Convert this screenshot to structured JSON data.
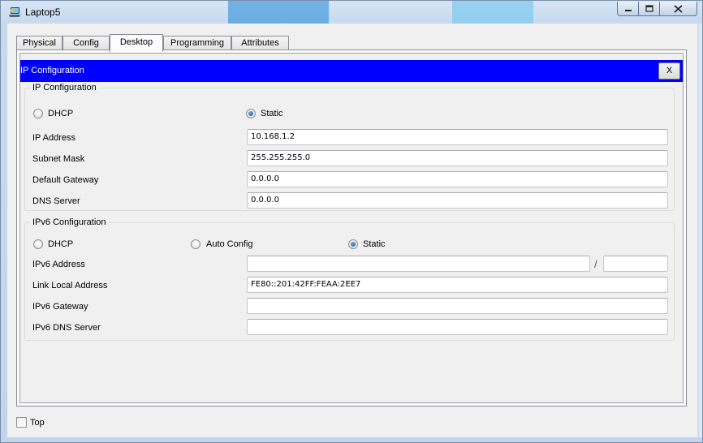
{
  "window": {
    "title": "Laptop5",
    "colors": {
      "header_bar": "#0000ff",
      "title_bar": "#d6e4f5"
    }
  },
  "tabs": [
    {
      "label": "Physical",
      "active": false
    },
    {
      "label": "Config",
      "active": false
    },
    {
      "label": "Desktop",
      "active": true
    },
    {
      "label": "Programming",
      "active": false
    },
    {
      "label": "Attributes",
      "active": false
    }
  ],
  "panel": {
    "header_title": "IP Configuration",
    "close_label": "X"
  },
  "ipv4": {
    "legend": "IP Configuration",
    "dhcp_label": "DHCP",
    "static_label": "Static",
    "mode": "Static",
    "ip_address_label": "IP Address",
    "ip_address": "10.168.1.2",
    "subnet_mask_label": "Subnet Mask",
    "subnet_mask": "255.255.255.0",
    "default_gateway_label": "Default Gateway",
    "default_gateway": "0.0.0.0",
    "dns_server_label": "DNS Server",
    "dns_server": "0.0.0.0"
  },
  "ipv6": {
    "legend": "IPv6 Configuration",
    "dhcp_label": "DHCP",
    "auto_label": "Auto Config",
    "static_label": "Static",
    "mode": "Static",
    "address_label": "IPv6 Address",
    "address": "",
    "prefix_separator": "/",
    "prefix": "",
    "link_local_label": "Link Local Address",
    "link_local": "FE80::201:42FF:FEAA:2EE7",
    "gateway_label": "IPv6 Gateway",
    "gateway": "",
    "dns_label": "IPv6 DNS Server",
    "dns": ""
  },
  "footer": {
    "top_label": "Top",
    "top_checked": false
  }
}
